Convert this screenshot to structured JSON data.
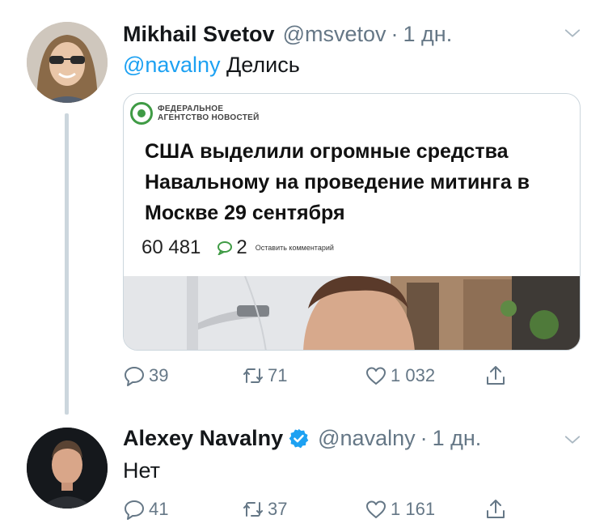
{
  "tweets": [
    {
      "name": "Mikhail Svetov",
      "handle": "@msvetov",
      "separator": "·",
      "time": "1 дн.",
      "mention": "@navalny",
      "text": "Делись",
      "card": {
        "logo_line1": "ФЕДЕРАЛЬНОЕ",
        "logo_line2": "АГЕНТСТВО НОВОСТЕЙ",
        "headline": "США выделили огромные средства Навальному на проведение митинга в Москве 29 сентября",
        "views": "60 481",
        "comments": "2",
        "leave_comment": "Оставить комментарий"
      },
      "actions": {
        "replies": "39",
        "retweets": "71",
        "likes": "1 032"
      }
    },
    {
      "name": "Alexey Navalny",
      "handle": "@navalny",
      "separator": "·",
      "time": "1 дн.",
      "text": "Нет",
      "verified": true,
      "actions": {
        "replies": "41",
        "retweets": "37",
        "likes": "1 161"
      }
    }
  ],
  "colors": {
    "accent": "#1da1f2",
    "secondary_text": "#657786",
    "primary_text": "#14171a",
    "border": "#ccd6dd",
    "logo_green": "#3f9b45"
  },
  "icons": [
    "caret-down-icon",
    "verified-badge-icon",
    "reply-icon",
    "retweet-icon",
    "like-icon",
    "share-icon",
    "comment-icon"
  ]
}
